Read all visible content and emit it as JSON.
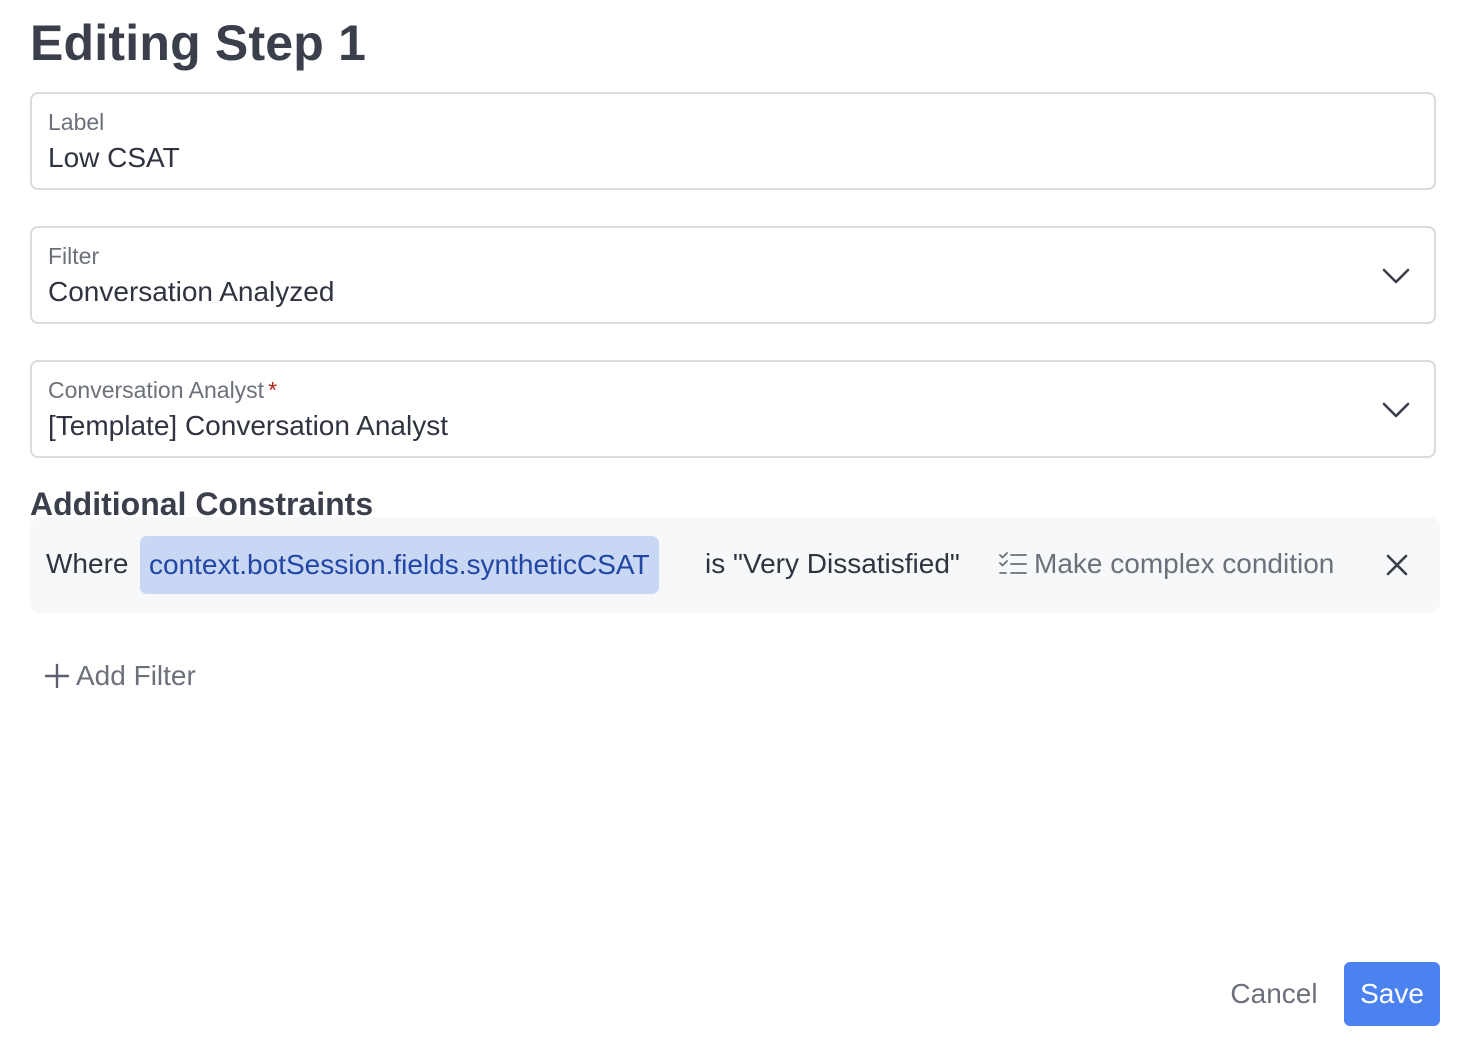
{
  "page": {
    "title": "Editing Step 1"
  },
  "fields": {
    "label": {
      "label": "Label",
      "value": "Low CSAT"
    },
    "filter": {
      "label": "Filter",
      "value": "Conversation Analyzed",
      "icon": "chevron-down-icon"
    },
    "analyst": {
      "label": "Conversation Analyst",
      "required_marker": "*",
      "value": "[Template] Conversation Analyst",
      "icon": "chevron-down-icon"
    }
  },
  "constraints": {
    "heading": "Additional Constraints",
    "items": [
      {
        "prefix": "Where",
        "field": "context.botSession.fields.syntheticCSAT",
        "condition": "is \"Very Dissatisfied\"",
        "complex_label": "Make complex condition",
        "complex_icon": "checklist-icon",
        "remove_icon": "close-icon"
      }
    ]
  },
  "add_filter": {
    "label": "Add Filter",
    "icon": "plus-icon"
  },
  "footer": {
    "cancel_label": "Cancel",
    "save_label": "Save"
  },
  "colors": {
    "primary": "#4b82f0",
    "chip_bg": "#c8d7f4",
    "chip_text": "#2346a5",
    "required": "#b3261e"
  }
}
